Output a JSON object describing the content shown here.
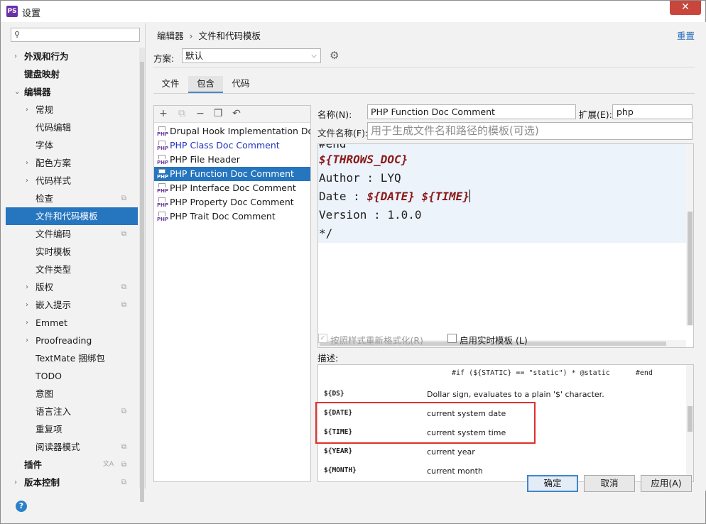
{
  "window": {
    "title": "设置",
    "close_glyph": "✕",
    "app_icon_text": "PS"
  },
  "sidebar": {
    "search": {
      "value": "",
      "placeholder": ""
    },
    "items": [
      {
        "label": "外观和行为",
        "arrow": "›",
        "bold": true
      },
      {
        "label": "键盘映射",
        "arrow": "",
        "bold": true
      },
      {
        "label": "编辑器",
        "arrow": "⌄",
        "bold": true
      },
      {
        "label": "常规",
        "arrow": "›"
      },
      {
        "label": "代码编辑",
        "arrow": ""
      },
      {
        "label": "字体",
        "arrow": ""
      },
      {
        "label": "配色方案",
        "arrow": "›"
      },
      {
        "label": "代码样式",
        "arrow": "›"
      },
      {
        "label": "检查",
        "arrow": "",
        "side_icon": "copy-icon"
      },
      {
        "label": "文件和代码模板",
        "arrow": "",
        "selected": true
      },
      {
        "label": "文件编码",
        "arrow": "",
        "side_icon": "copy-icon"
      },
      {
        "label": "实时模板",
        "arrow": ""
      },
      {
        "label": "文件类型",
        "arrow": ""
      },
      {
        "label": "版权",
        "arrow": "›",
        "side_icon": "copy-icon"
      },
      {
        "label": "嵌入提示",
        "arrow": "›",
        "side_icon": "copy-icon"
      },
      {
        "label": "Emmet",
        "arrow": "›"
      },
      {
        "label": "Proofreading",
        "arrow": "›"
      },
      {
        "label": "TextMate 捆绑包",
        "arrow": ""
      },
      {
        "label": "TODO",
        "arrow": ""
      },
      {
        "label": "意图",
        "arrow": ""
      },
      {
        "label": "语言注入",
        "arrow": "",
        "side_icon": "copy-icon"
      },
      {
        "label": "重复项",
        "arrow": ""
      },
      {
        "label": "阅读器模式",
        "arrow": "",
        "side_icon": "copy-icon"
      },
      {
        "label": "插件",
        "arrow": "",
        "bold": true,
        "side_icon": "copy-icon",
        "lang_icon": "translate-icon"
      },
      {
        "label": "版本控制",
        "arrow": "›",
        "bold": true,
        "side_icon": "copy-icon"
      }
    ]
  },
  "header": {
    "breadcrumb": [
      "编辑器",
      "文件和代码模板"
    ],
    "breadcrumb_sep": "›",
    "reset_label": "重置"
  },
  "scheme": {
    "label": "方案:",
    "value": "默认"
  },
  "tabs": [
    {
      "label": "文件",
      "active": false
    },
    {
      "label": "包含",
      "active": true
    },
    {
      "label": "代码",
      "active": false
    }
  ],
  "toolbar_glyphs": {
    "add": "+",
    "copy_disabled": "⧉",
    "remove": "−",
    "duplicate": "❐",
    "revert": "↶"
  },
  "templates": [
    {
      "name": "Drupal Hook Implementation Doc",
      "state": "normal"
    },
    {
      "name": "PHP Class Doc Comment",
      "state": "modified"
    },
    {
      "name": "PHP File Header",
      "state": "normal"
    },
    {
      "name": "PHP Function Doc Comment",
      "state": "selected"
    },
    {
      "name": "PHP Interface Doc Comment",
      "state": "normal"
    },
    {
      "name": "PHP Property Doc Comment",
      "state": "normal"
    },
    {
      "name": "PHP Trait Doc Comment",
      "state": "normal"
    }
  ],
  "form": {
    "name_label": "名称(N):",
    "name_value": "PHP Function Doc Comment",
    "ext_label": "扩展(E):",
    "ext_value": "php",
    "filename_label": "文件名称(F):",
    "filename_placeholder": "用于生成文件名和路径的模板(可选)"
  },
  "code": {
    "line0": "#end",
    "line1_var": "${THROWS_DOC}",
    "line2": "Author : LYQ",
    "line3_prefix": "Date : ",
    "line3_var1": "${DATE}",
    "line3_space": " ",
    "line3_var2": "${TIME}",
    "line4": "Version : 1.0.0",
    "line5": "*/"
  },
  "options": {
    "reformat_label": "按照样式重新格式化(R)",
    "reformat_checked": true,
    "reformat_enabled": false,
    "live_template_label": "启用实时模板 (L)",
    "live_template_checked": false
  },
  "description": {
    "label": "描述:",
    "top_snippet": "#if (${STATIC} == \"static\") * @static      #end",
    "rows": [
      {
        "key": "${DS}",
        "value": "Dollar sign, evaluates to a plain '$' character."
      },
      {
        "key": "${DATE}",
        "value": "current system date"
      },
      {
        "key": "${TIME}",
        "value": "current system time"
      },
      {
        "key": "${YEAR}",
        "value": "current year"
      },
      {
        "key": "${MONTH}",
        "value": "current month"
      }
    ]
  },
  "buttons": {
    "ok": "确定",
    "cancel": "取消",
    "apply": "应用(A)"
  },
  "colors": {
    "selection": "#2675bf",
    "link": "#2469b8",
    "variable": "#8b1a1a",
    "highlight_box": "#e0302a"
  }
}
